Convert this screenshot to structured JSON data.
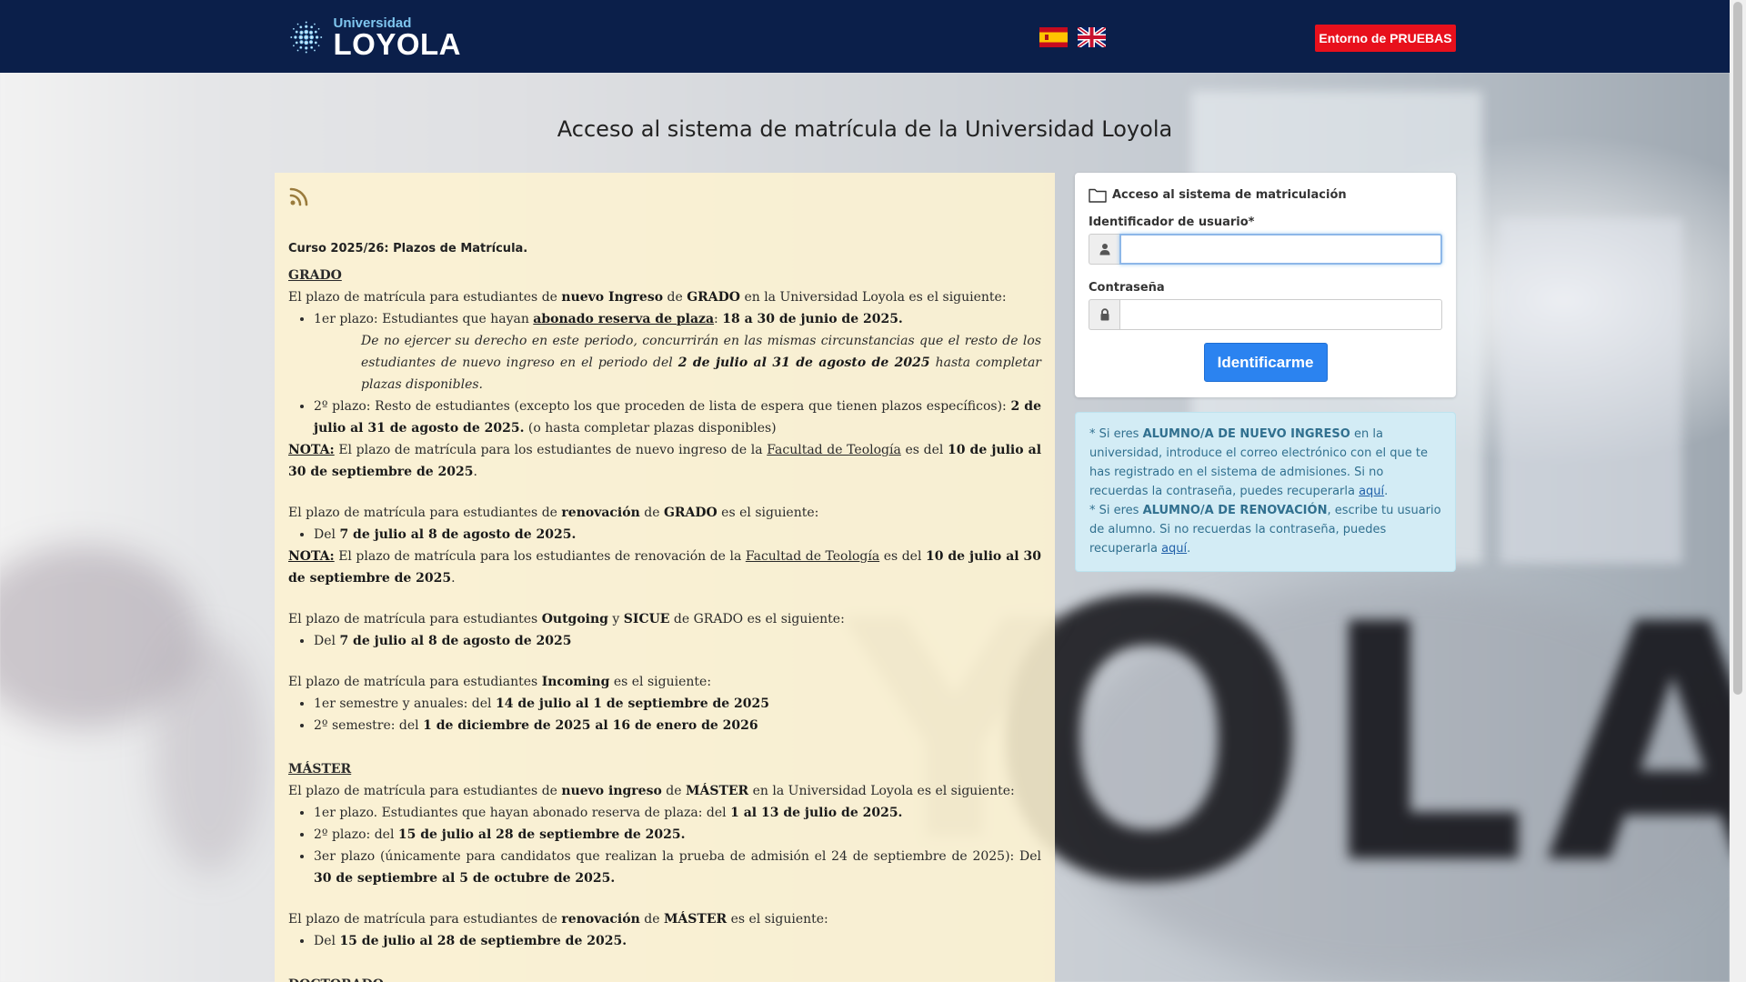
{
  "header": {
    "logo_small": "Universidad",
    "logo_big": "LOYOLA",
    "flags": [
      "spanish-flag",
      "uk-flag"
    ],
    "env_button": "Entorno de PRUEBAS",
    "color": "#0b1f4a",
    "env_color": "#e8101c"
  },
  "title": "Acceso al sistema de matrícula de la Universidad Loyola",
  "news": {
    "heading": "Curso 2025/26: Plazos de Matrícula.",
    "grado": {
      "title": "GRADO",
      "intro_a": "El plazo de matrícula para estudiantes de ",
      "intro_b": "nuevo Ingreso",
      "intro_c": " de ",
      "intro_d": "GRADO",
      "intro_e": " en la Universidad Loyola es el siguiente:",
      "item1_a": "1er plazo: Estudiantes que hayan ",
      "item1_b": "abonado reserva de plaza",
      "item1_c": ": ",
      "item1_d": "18 a 30 de junio de 2025.",
      "note1_a": "De no ejercer su derecho en este periodo, concurrirán en las mismas circunstancias que el resto de los estudiantes de nuevo ingreso en el periodo del ",
      "note1_b": "2 de julio al 31 de agosto de 2025",
      "note1_c": " hasta completar plazas disponibles.",
      "item2_a": "2º plazo: Resto de estudiantes (excepto los que proceden de lista de espera que tienen plazos específicos): ",
      "item2_b": "2 de julio al 31 de agosto de 2025.",
      "item2_c": " (o hasta completar plazas disponibles)",
      "nota1_label": "NOTA:",
      "nota1_a": " El plazo de matrícula para los estudiantes de nuevo ingreso de la ",
      "nota1_link": "Facultad de Teología",
      "nota1_b": " es del ",
      "nota1_c": "10 de julio al 30 de septiembre de 2025",
      "nota1_d": ".",
      "renov_a": "El plazo de matrícula para estudiantes de ",
      "renov_b": "renovación",
      "renov_c": " de ",
      "renov_d": "GRADO",
      "renov_e": " es el siguiente:",
      "renov_item_a": "Del ",
      "renov_item_b": "7 de julio al 8 de agosto de 2025.",
      "nota2_label": "NOTA:",
      "nota2_a": " El plazo de matrícula para los estudiantes de renovación de la ",
      "nota2_link": "Facultad de Teología",
      "nota2_b": " es del ",
      "nota2_c": "10 de julio al 30 de septiembre de 2025",
      "nota2_d": ".",
      "out_a": "El plazo de matrícula para estudiantes ",
      "out_b": "Outgoing",
      "out_c": " y ",
      "out_d": "SICUE",
      "out_e": " de GRADO es el siguiente:",
      "out_item_a": "Del ",
      "out_item_b": "7 de julio al 8 de agosto de 2025",
      "inc_a": "El plazo de matrícula para estudiantes ",
      "inc_b": "Incoming",
      "inc_c": " es el siguiente:",
      "inc_item1_a": "1er semestre y anuales: del ",
      "inc_item1_b": "14 de julio al 1 de septiembre de 2025",
      "inc_item2_a": "2º semestre: del ",
      "inc_item2_b": "1 de diciembre de 2025 al 16 de enero de 2026"
    },
    "master": {
      "title": "MÁSTER",
      "intro_a": "El plazo de matrícula para estudiantes de ",
      "intro_b": "nuevo ingreso",
      "intro_c": " de ",
      "intro_d": "MÁSTER",
      "intro_e": " en la Universidad Loyola es el siguiente:",
      "item1_a": "1er plazo. Estudiantes que hayan abonado reserva de plaza: del ",
      "item1_b": "1 al 13 de julio de 2025.",
      "item2_a": "2º plazo: del ",
      "item2_b": "15 de julio al 28 de septiembre de 2025.",
      "item3_a": "3er plazo (únicamente para candidatos que realizan la prueba de admisión el 24 de septiembre de 2025): Del ",
      "item3_b": "30 de septiembre al 5 de octubre de 2025.",
      "renov_a": "El plazo de matrícula para estudiantes de ",
      "renov_b": "renovación",
      "renov_c": " de ",
      "renov_d": "MÁSTER",
      "renov_e": " es el siguiente:",
      "renov_item_a": "Del ",
      "renov_item_b": "15 de julio al 28 de septiembre de 2025."
    },
    "doctorado": {
      "title": "DOCTORADO"
    }
  },
  "login": {
    "card_title": "Acceso al sistema de matriculación",
    "user_label": "Identificador de usuario*",
    "user_value": "",
    "password_label": "Contraseña",
    "password_value": "",
    "submit": "Identificarme",
    "button_color": "#2b83f0"
  },
  "info": {
    "line1_a": "* Si eres ",
    "line1_b": "ALUMNO/A DE NUEVO INGRESO",
    "line1_c": " en la universidad, introduce el correo electrónico con el que te has registrado en el sistema de admisiones. Si no recuerdas la contraseña, puedes recuperarla ",
    "link1": "aquí",
    "line1_d": ".",
    "line2_a": "* Si eres ",
    "line2_b": "ALUMNO/A DE RENOVACIÓN",
    "line2_c": ", escribe tu usuario de alumno. Si no recuerdas la contraseña, puedes recuperarla ",
    "link2": "aquí",
    "line2_d": "."
  }
}
